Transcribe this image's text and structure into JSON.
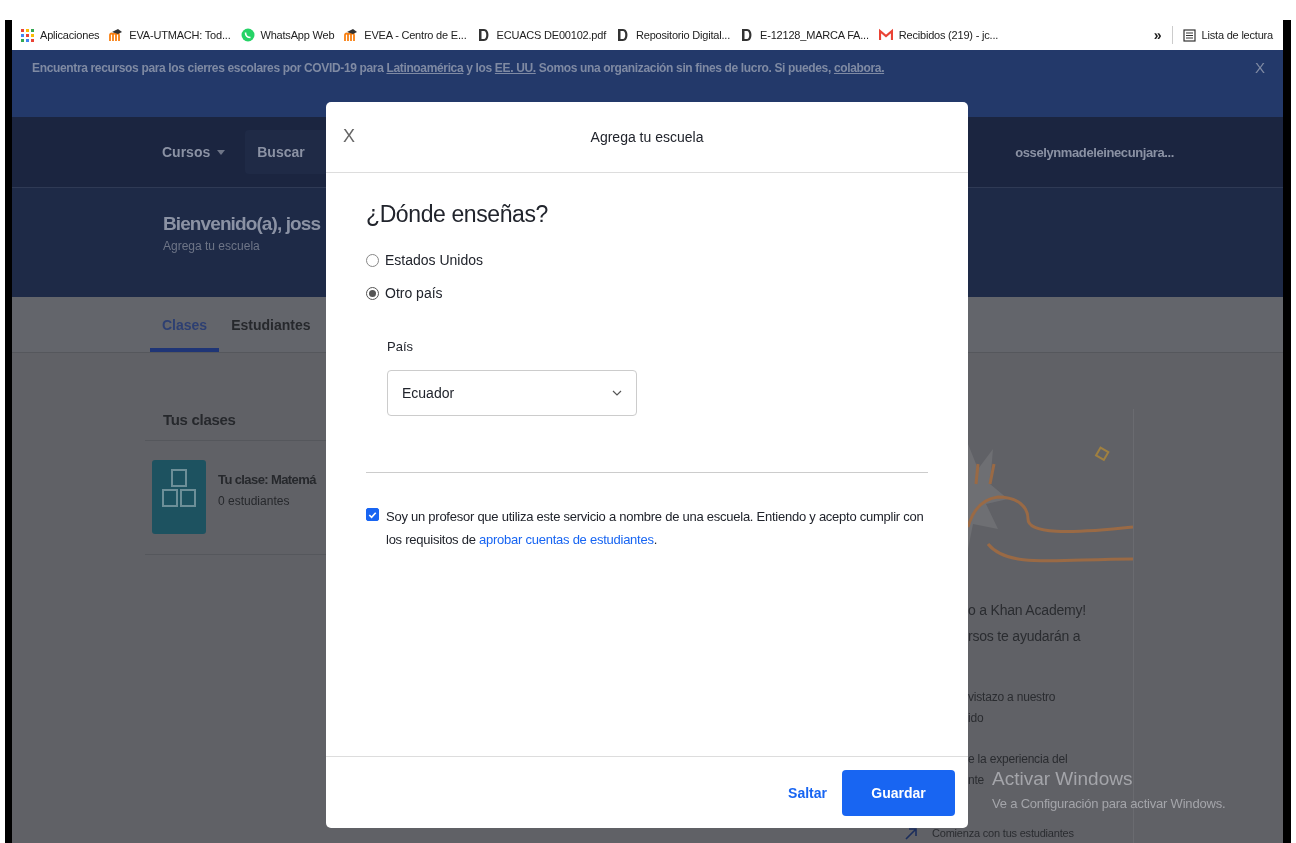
{
  "bookmarks": [
    {
      "kind": "apps",
      "label": "Aplicaciones"
    },
    {
      "kind": "moodle",
      "label": "EVA-UTMACH: Tod..."
    },
    {
      "kind": "whatsapp",
      "label": "WhatsApp Web"
    },
    {
      "kind": "moodle",
      "label": "EVEA - Centro de E..."
    },
    {
      "kind": "doc",
      "label": "ECUACS DE00102.pdf"
    },
    {
      "kind": "doc",
      "label": "Repositorio Digital..."
    },
    {
      "kind": "doc",
      "label": "E-12128_MARCA FA..."
    },
    {
      "kind": "gmail",
      "label": "Recibidos (219) - jc..."
    }
  ],
  "bookmarks_more": "»",
  "reading_list": "Lista de lectura",
  "banner": {
    "segments": [
      {
        "kind": "text",
        "text": "Encuentra recursos para los cierres escolares por COVID-19 para "
      },
      {
        "kind": "link",
        "text": "Latinoamérica"
      },
      {
        "kind": "text",
        "text": " y los "
      },
      {
        "kind": "link",
        "text": "EE. UU."
      },
      {
        "kind": "text",
        "text": " Somos una organización sin fines de lucro. Si puedes, "
      },
      {
        "kind": "link",
        "text": "colabora."
      }
    ],
    "close": "X"
  },
  "nav": {
    "courses": "Cursos",
    "search_placeholder": "Buscar",
    "user": "osselynmadeleinecunjara..."
  },
  "header": {
    "title": "Bienvenido(a), joss",
    "subtitle": "Agrega tu escuela"
  },
  "tabs": [
    {
      "label": "Clases",
      "selected": true
    },
    {
      "label": "Estudiantes",
      "selected": false
    }
  ],
  "classes": {
    "title": "Tus clases",
    "items": [
      {
        "title": "Tu clase: Matemá",
        "students": "0 estudiantes"
      }
    ]
  },
  "side_card": {
    "blocks": [
      {
        "kind": "partial",
        "lines": [
          "o a Khan Academy!",
          "rsos te ayudarán a"
        ]
      },
      {
        "kind": "partial",
        "lines": [
          "vistazo a nuestro",
          "ido"
        ]
      },
      {
        "kind": "partial",
        "lines": [
          "e la experiencia del",
          "nte"
        ]
      },
      {
        "kind": "step",
        "lines": [
          "Comienza con tus estudiantes"
        ]
      }
    ]
  },
  "dialog": {
    "close": "X",
    "title": "Agrega tu escuela",
    "heading": "¿Dónde enseñas?",
    "options": [
      {
        "label": "Estados Unidos",
        "selected": false
      },
      {
        "label": "Otro país",
        "selected": true
      }
    ],
    "country_label": "País",
    "country_value": "Ecuador",
    "agreement": {
      "checked": true,
      "text": "Soy un profesor que utiliza este servicio a nombre de una escuela. Entiendo y acepto cumplir con los requisitos de ",
      "link": "aprobar cuentas de estudiantes",
      "end": "."
    },
    "skip": "Saltar",
    "save": "Guardar"
  },
  "os_notice": {
    "title": "Activar Windows",
    "text": "Ve a Configuración para activar Windows."
  }
}
